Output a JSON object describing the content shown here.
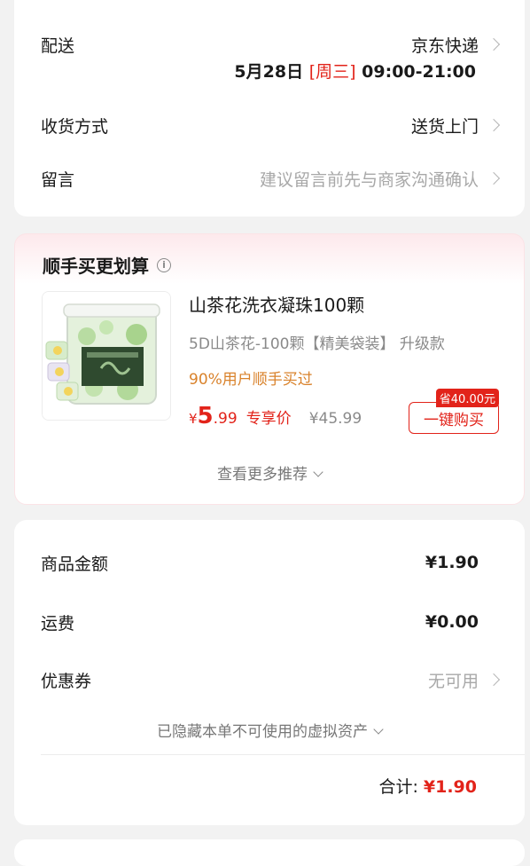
{
  "delivery": {
    "shipping_label": "配送",
    "shipping_value": "京东快递",
    "date": "5月28日",
    "weekday": "[周三]",
    "time": "09:00-21:00",
    "receive_label": "收货方式",
    "receive_value": "送货上门",
    "note_label": "留言",
    "note_placeholder": "建议留言前先与商家沟通确认"
  },
  "addon": {
    "title": "顺手买更划算",
    "info_glyph": "i",
    "product": {
      "name": "山茶花洗衣凝珠100颗",
      "spec": "5D山茶花-100颗【精美袋装】 升级款",
      "buyers": "90%用户顺手买过",
      "price_symbol": "¥",
      "price_int": "5",
      "price_dec": ".99",
      "price_tag": "专享价",
      "original_price": "¥45.99",
      "save_badge": "省40.00元",
      "buy_button": "一键购买"
    },
    "more_link": "查看更多推荐"
  },
  "summary": {
    "goods_label": "商品金额",
    "goods_value": "¥1.90",
    "freight_label": "运费",
    "freight_value": "¥0.00",
    "coupon_label": "优惠券",
    "coupon_value": "无可用",
    "hidden_assets": "已隐藏本单不可使用的虚拟资产",
    "total_label": "合计:",
    "total_value": "¥1.90"
  },
  "colors": {
    "accent": "#e2231a",
    "orange": "#d9822b",
    "muted": "#a8a8a8",
    "background": "#f2f2f2"
  }
}
